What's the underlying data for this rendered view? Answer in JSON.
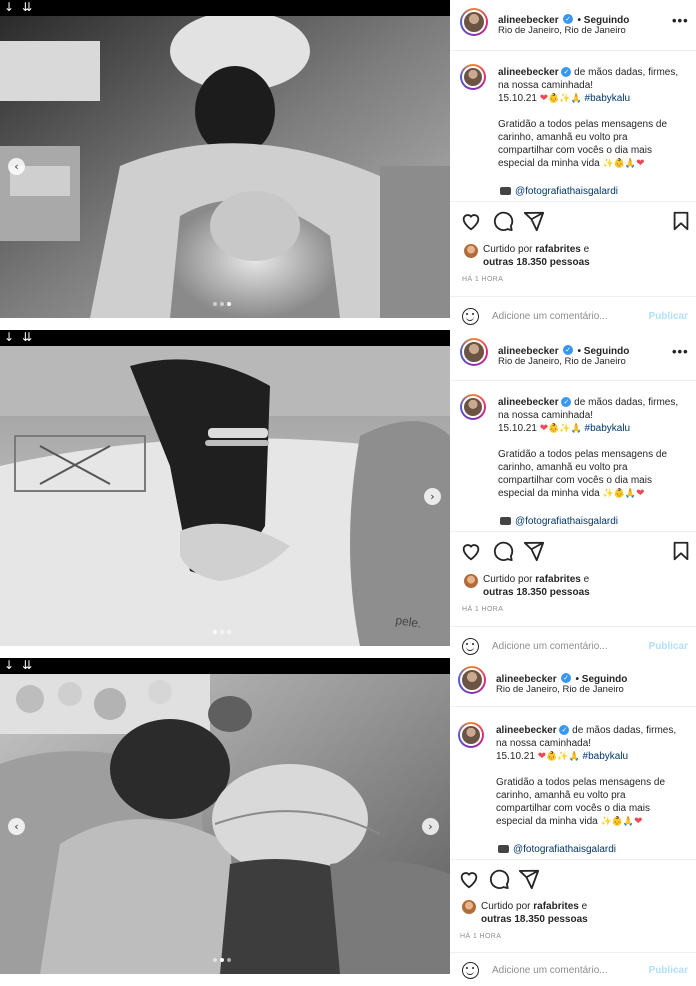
{
  "colors": {
    "accent": "#3897f0",
    "link": "#00376b",
    "heart": "#ed4956",
    "muted": "#8e8e8e",
    "publish": "#b2dffc"
  },
  "topbar": {
    "arrow_left": "↓",
    "arrow_right": "⇊"
  },
  "nav": {
    "prev": "‹",
    "next": "›"
  },
  "posts": [
    {
      "username": "alineebecker",
      "following": "• Seguindo",
      "location": "Rio de Janeiro, Rio de Janeiro",
      "more": "•••",
      "caption_text": "de mãos dadas, firmes, na nossa caminhada!",
      "date": "15.10.21",
      "emojis": "👶✨🙏",
      "hashtag": "#babykalu",
      "body": "Gratidão a todos pelas mensagens de carinho, amanhã eu volto pra compartilhar com vocês o dia mais especial da minha vida",
      "body_emojis": "✨👶🙏",
      "heart": "❤",
      "photo_credit": "@fotografiathaisgalardi",
      "liked_prefix": "Curtido por",
      "liked_user": "rafabrites",
      "liked_and": "e",
      "liked_others": "outras 18.350 pessoas",
      "time_ago": "HÁ 1 HORA",
      "comment_placeholder": "Adicione um comentário...",
      "publish_label": "Publicar",
      "carousel_active": 3
    },
    {
      "username": "alineebecker",
      "following": "• Seguindo",
      "location": "Rio de Janeiro, Rio de Janeiro",
      "more": "•••",
      "caption_text": "de mãos dadas, firmes, na nossa caminhada!",
      "date": "15.10.21",
      "emojis": "👶✨🙏",
      "hashtag": "#babykalu",
      "body": "Gratidão a todos pelas mensagens de carinho, amanhã eu volto pra compartilhar com vocês o dia mais especial da minha vida",
      "body_emojis": "✨👶🙏",
      "heart": "❤",
      "photo_credit": "@fotografiathaisgalardi",
      "liked_prefix": "Curtido por",
      "liked_user": "rafabrites",
      "liked_and": "e",
      "liked_others": "outras 18.350 pessoas",
      "time_ago": "HÁ 1 HORA",
      "comment_placeholder": "Adicione um comentário...",
      "publish_label": "Publicar",
      "carousel_active": 1,
      "photo_text": "pele."
    },
    {
      "username": "alineebecker",
      "following": "• Seguindo",
      "location": "Rio de Janeiro, Rio de Janeiro",
      "more": "•••",
      "caption_text": "de mãos dadas, firmes, na nossa caminhada!",
      "date": "15.10.21",
      "emojis": "👶✨🙏",
      "hashtag": "#babykalu",
      "body": "Gratidão a todos pelas mensagens de carinho, amanhã eu volto pra compartilhar com vocês o dia mais especial da minha vida",
      "body_emojis": "✨👶🙏",
      "heart": "❤",
      "photo_credit": "@fotografiathaisgalardi",
      "liked_prefix": "Curtido por",
      "liked_user": "rafabrites",
      "liked_and": "e",
      "liked_others": "outras 18.350 pessoas",
      "time_ago": "HÁ 1 HORA",
      "comment_placeholder": "Adicione um comentário...",
      "publish_label": "Publicar",
      "carousel_active": 2
    }
  ]
}
